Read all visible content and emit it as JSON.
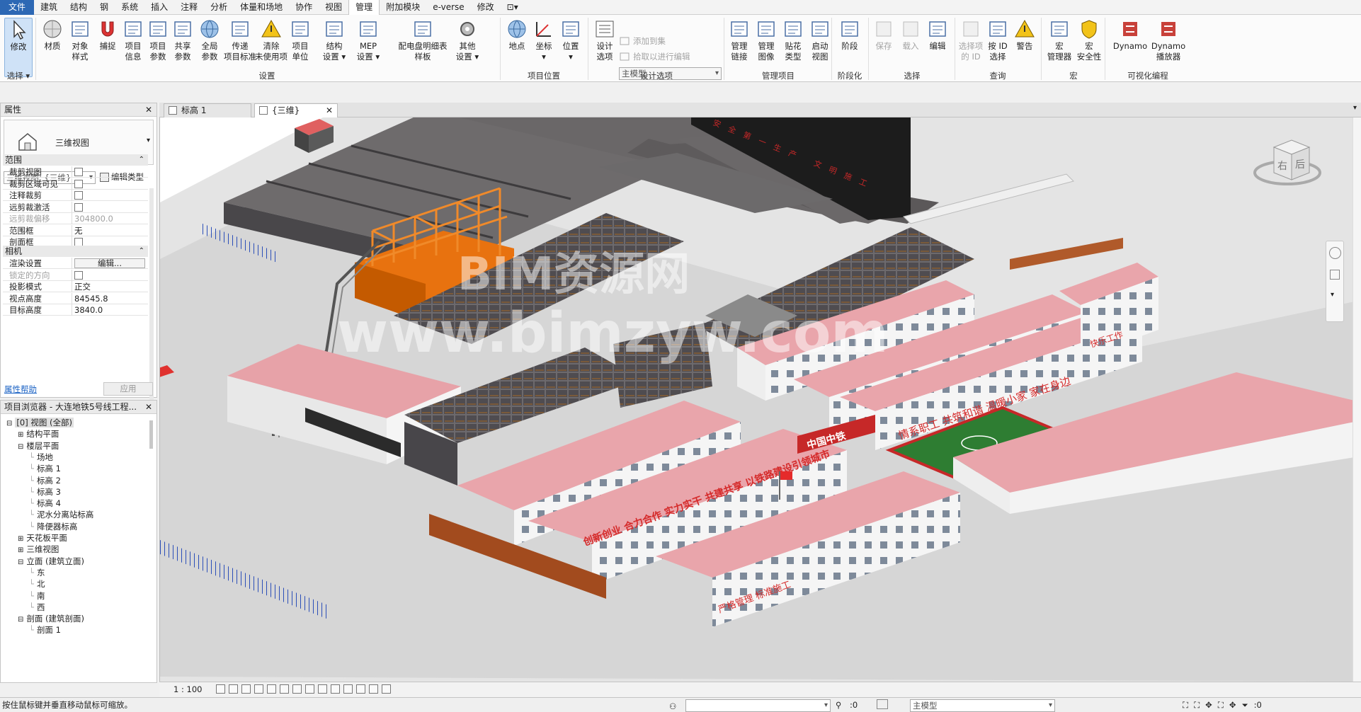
{
  "menu": [
    "文件",
    "建筑",
    "结构",
    "钢",
    "系统",
    "插入",
    "注释",
    "分析",
    "体量和场地",
    "协作",
    "视图",
    "管理",
    "附加模块",
    "e-verse",
    "修改",
    "⊡▾"
  ],
  "ribbon": {
    "select_group": {
      "modify": "修改",
      "select": "选择 ▾"
    },
    "settings": [
      "材质",
      "对象样式",
      "捕捉",
      "项目信息",
      "项目参数",
      "共享参数",
      "全局参数",
      "传递项目标准",
      "清除未使用项",
      "项目单位",
      "结构设置",
      "MEP设置",
      "配电盘明细表样板",
      "其他设置"
    ],
    "settings_lines": [
      [
        "材质"
      ],
      [
        "对象",
        "样式"
      ],
      [
        "捕捉"
      ],
      [
        "项目",
        "信息"
      ],
      [
        "项目",
        "参数"
      ],
      [
        "共享",
        "参数"
      ],
      [
        "全局",
        "参数"
      ],
      [
        "传递",
        "项目标准"
      ],
      [
        "清除",
        "未使用项"
      ],
      [
        "项目",
        "单位"
      ],
      [
        "结构",
        "设置 ▾"
      ],
      [
        "MEP",
        "设置 ▾"
      ],
      [
        "配电盘明细表",
        "样板"
      ],
      [
        "其他",
        "设置 ▾"
      ]
    ],
    "settings_group": "设置",
    "location": [
      [
        "地点"
      ],
      [
        "坐标",
        "▾"
      ],
      [
        "位置",
        "▾"
      ]
    ],
    "location_group": "项目位置",
    "design_options": {
      "btn": [
        "设计",
        "选项"
      ],
      "add": "添加到集",
      "pick": "拾取以进行编辑",
      "combo": "主模型",
      "group": "设计选项"
    },
    "manage_project": [
      [
        "管理",
        "链接"
      ],
      [
        "管理",
        "图像"
      ],
      [
        "贴花",
        "类型"
      ],
      [
        "启动",
        "视图"
      ]
    ],
    "manage_project_group": "管理项目",
    "phasing": [
      [
        "阶段"
      ]
    ],
    "phasing_group": "阶段化",
    "selection": [
      [
        "保存"
      ],
      [
        "载入"
      ],
      [
        "编辑"
      ]
    ],
    "selection_group": "选择",
    "inquiry": [
      [
        "选择项",
        "的 ID"
      ],
      [
        "按 ID",
        "选择"
      ],
      [
        "警告"
      ]
    ],
    "inquiry_group": "查询",
    "macros": [
      [
        "宏",
        "管理器"
      ],
      [
        "宏",
        "安全性"
      ]
    ],
    "macros_group": "宏",
    "dynamo": [
      [
        "Dynamo"
      ],
      [
        "Dynamo",
        "播放器"
      ]
    ],
    "dynamo_group": "可视化编程"
  },
  "properties": {
    "title": "属性",
    "type_name": "三维视图",
    "instance": "三维视图: {三维}",
    "edit_type": "编辑类型",
    "sec_extent": "范围",
    "rows1": [
      {
        "k": "裁剪视图",
        "v": "",
        "cb": true,
        "dis": false
      },
      {
        "k": "裁剪区域可见",
        "v": "",
        "cb": true,
        "dis": false
      },
      {
        "k": "注释裁剪",
        "v": "",
        "cb": true,
        "dis": false
      },
      {
        "k": "远剪裁激活",
        "v": "",
        "cb": true,
        "dis": false
      },
      {
        "k": "远剪裁偏移",
        "v": "304800.0",
        "cb": false,
        "dis": true
      },
      {
        "k": "范围框",
        "v": "无",
        "cb": false,
        "dis": false
      },
      {
        "k": "剖面框",
        "v": "",
        "cb": true,
        "dis": false
      }
    ],
    "sec_camera": "相机",
    "rows2": [
      {
        "k": "渲染设置",
        "v": "编辑...",
        "cb": false,
        "dis": false,
        "btn": true
      },
      {
        "k": "锁定的方向",
        "v": "",
        "cb": true,
        "dis": true
      },
      {
        "k": "投影模式",
        "v": "正交",
        "cb": false,
        "dis": false
      },
      {
        "k": "视点高度",
        "v": "84545.8",
        "cb": false,
        "dis": false
      },
      {
        "k": "目标高度",
        "v": "3840.0",
        "cb": false,
        "dis": false
      }
    ],
    "help": "属性帮助",
    "apply": "应用"
  },
  "browser": {
    "title": "项目浏览器 - 大连地铁5号线工程...",
    "items": [
      {
        "t": "[0] 视图 (全部)",
        "lvl": 0,
        "exp": "⊟"
      },
      {
        "t": "结构平面",
        "lvl": 1,
        "exp": "⊞"
      },
      {
        "t": "楼层平面",
        "lvl": 1,
        "exp": "⊟"
      },
      {
        "t": "场地",
        "lvl": 2,
        "exp": ""
      },
      {
        "t": "标高 1",
        "lvl": 2,
        "exp": ""
      },
      {
        "t": "标高 2",
        "lvl": 2,
        "exp": ""
      },
      {
        "t": "标高 3",
        "lvl": 2,
        "exp": ""
      },
      {
        "t": "标高 4",
        "lvl": 2,
        "exp": ""
      },
      {
        "t": "泥水分离站标高",
        "lvl": 2,
        "exp": ""
      },
      {
        "t": "降便器标高",
        "lvl": 2,
        "exp": ""
      },
      {
        "t": "天花板平面",
        "lvl": 1,
        "exp": "⊞"
      },
      {
        "t": "三维视图",
        "lvl": 1,
        "exp": "⊞"
      },
      {
        "t": "立面 (建筑立面)",
        "lvl": 1,
        "exp": "⊟"
      },
      {
        "t": "东",
        "lvl": 2,
        "exp": ""
      },
      {
        "t": "北",
        "lvl": 2,
        "exp": ""
      },
      {
        "t": "南",
        "lvl": 2,
        "exp": ""
      },
      {
        "t": "西",
        "lvl": 2,
        "exp": ""
      },
      {
        "t": "剖面 (建筑剖面)",
        "lvl": 1,
        "exp": "⊟"
      },
      {
        "t": "剖面 1",
        "lvl": 2,
        "exp": ""
      }
    ]
  },
  "tabs": [
    {
      "label": "标高 1",
      "active": false
    },
    {
      "label": "{三维}",
      "active": true
    }
  ],
  "viewcube": {
    "right": "右",
    "back": "后"
  },
  "watermark": {
    "line1": "BIM资源网",
    "line2": "www.bimzyw.com"
  },
  "signs": {
    "slogan1": "创新创业 合力合作 实力实干 共建共享 以铁路建设引领城市",
    "slogan2": "情系职工 共筑和谐 温暖小家 家在身边",
    "slogan3": "快乐工作",
    "china": "中国中铁",
    "wall": "安全第一生产 文明施工",
    "bottom": "严格管理 标准施工"
  },
  "view_bar": {
    "scale": "1 : 100"
  },
  "status": {
    "hint": "按住鼠标键并垂直移动鼠标可缩放。",
    "count": ":0",
    "model": "主模型",
    "filter": ":0"
  }
}
